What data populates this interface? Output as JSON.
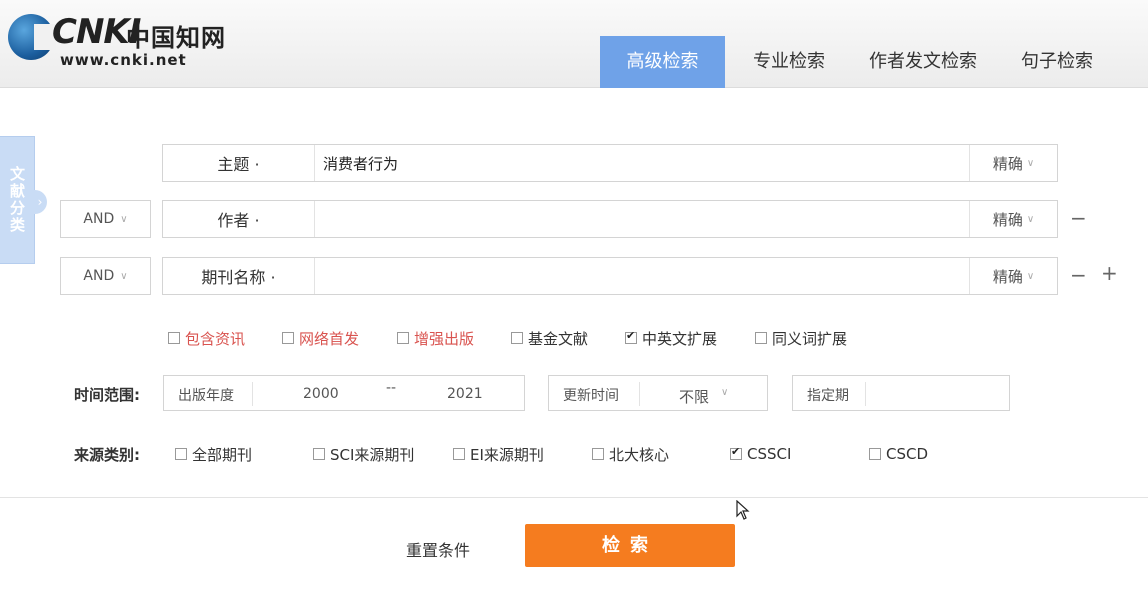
{
  "logo": {
    "cnki": "CNKI",
    "cn": "中国知网",
    "url": "www.cnki.net"
  },
  "tabs": [
    {
      "label": "高级检索"
    },
    {
      "label": "专业检索"
    },
    {
      "label": "作者发文检索"
    },
    {
      "label": "句子检索"
    }
  ],
  "side_tab": {
    "label": "文献分类"
  },
  "rows": [
    {
      "logic": "",
      "field": "主题 ·",
      "value": "消费者行为",
      "mode": "精确"
    },
    {
      "logic": "AND",
      "field": "作者 ·",
      "value": "",
      "mode": "精确"
    },
    {
      "logic": "AND",
      "field": "期刊名称 ·",
      "value": "",
      "mode": "精确"
    }
  ],
  "ops": {
    "minus": "−",
    "plus": "+"
  },
  "options": [
    {
      "label": "包含资讯",
      "checked": false,
      "color": "#d9534f"
    },
    {
      "label": "网络首发",
      "checked": false,
      "color": "#d9534f"
    },
    {
      "label": "增强出版",
      "checked": false,
      "color": "#d9534f"
    },
    {
      "label": "基金文献",
      "checked": false,
      "color": "#333333"
    },
    {
      "label": "中英文扩展",
      "checked": true,
      "color": "#333333"
    },
    {
      "label": "同义词扩展",
      "checked": false,
      "color": "#333333"
    }
  ],
  "time": {
    "label": "时间范围:",
    "year_label": "出版年度",
    "from": "2000",
    "sep": "--",
    "to": "2021",
    "update_label": "更新时间",
    "update_value": "不限",
    "period_label": "指定期"
  },
  "source": {
    "label": "来源类别:",
    "items": [
      {
        "label": "全部期刊",
        "checked": false
      },
      {
        "label": "SCI来源期刊",
        "checked": false
      },
      {
        "label": "EI来源期刊",
        "checked": false
      },
      {
        "label": "北大核心",
        "checked": false
      },
      {
        "label": "CSSCI",
        "checked": true
      },
      {
        "label": "CSCD",
        "checked": false
      }
    ]
  },
  "actions": {
    "reset": "重置条件",
    "search": "检索"
  }
}
